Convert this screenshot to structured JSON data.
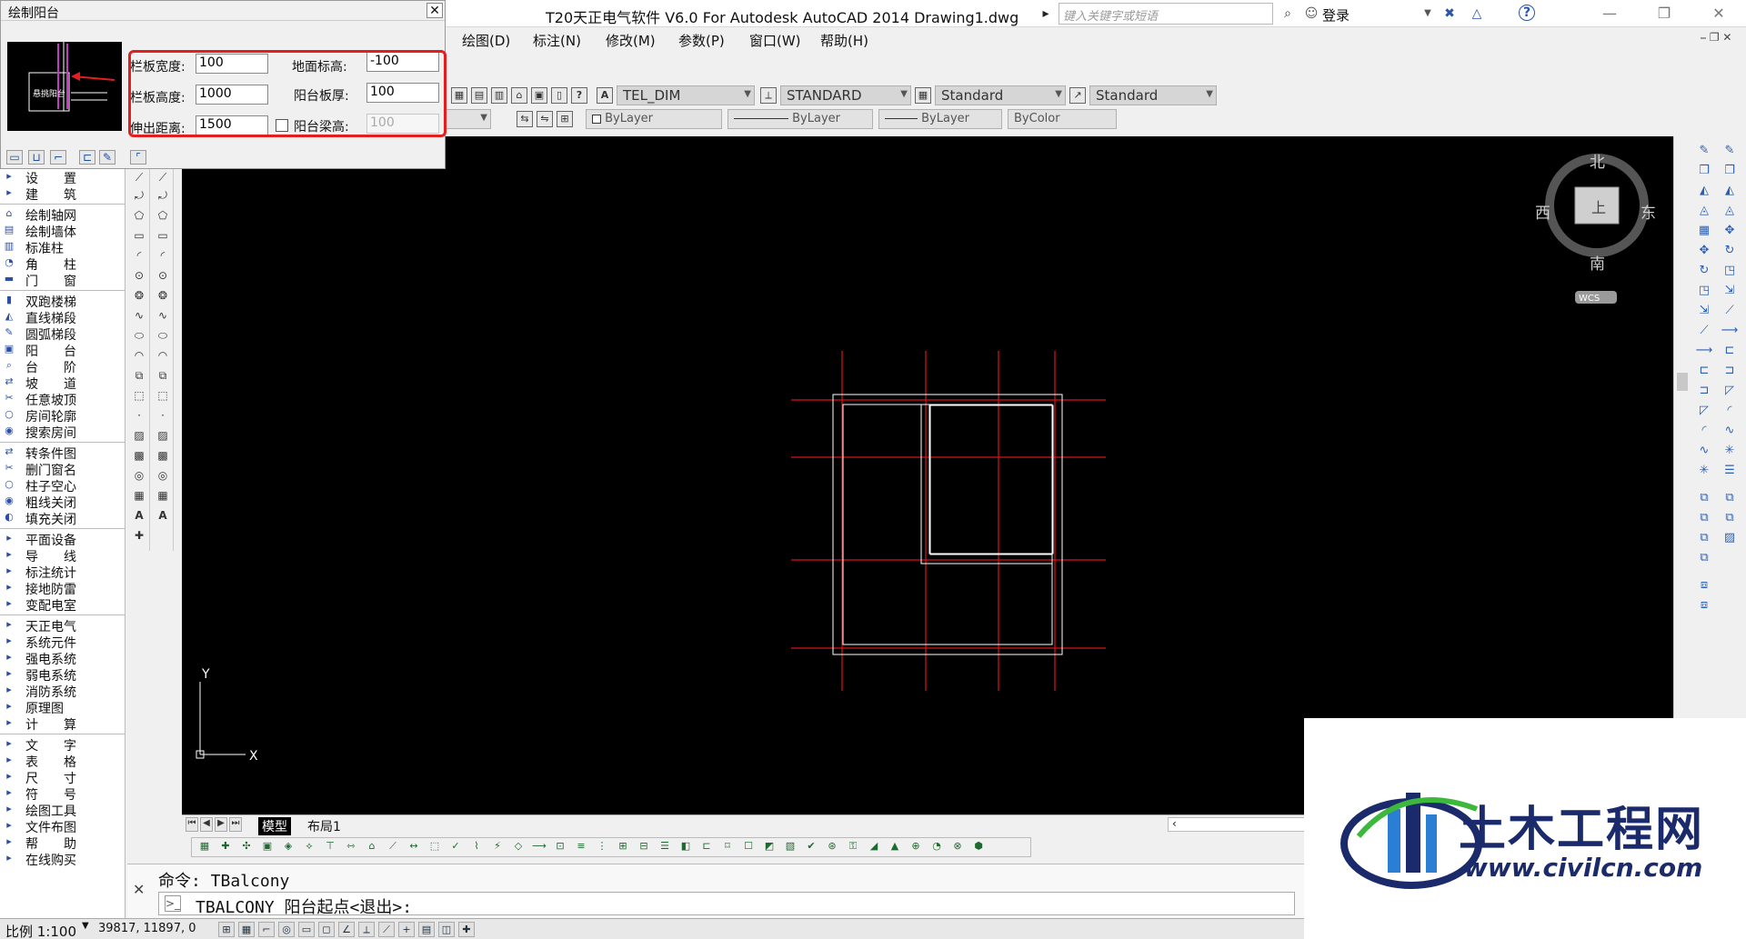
{
  "window": {
    "title": "T20天正电气软件 V6.0 For Autodesk AutoCAD 2014    Drawing1.dwg",
    "search_placeholder": "键入关键字或短语",
    "login_label": "登录",
    "help_label": "?"
  },
  "menubar": {
    "items": [
      "绘图(D)",
      "标注(N)",
      "修改(M)",
      "参数(P)",
      "窗口(W)",
      "帮助(H)"
    ]
  },
  "toolbar": {
    "text_style": "TEL_DIM",
    "dim_style": "STANDARD",
    "table_style": "Standard",
    "multileader_style": "Standard",
    "color": "ByLayer",
    "linetype": "ByLayer",
    "lineweight": "ByLayer",
    "plotstyle": "ByColor"
  },
  "dialog": {
    "title": "绘制阳台",
    "preview_label": "悬挑阳台",
    "fields": {
      "rail_width_label": "栏板宽度:",
      "rail_width": "100",
      "rail_height_label": "栏板高度:",
      "rail_height": "1000",
      "extend_label": "伸出距离:",
      "extend": "1500",
      "ground_elev_label": "地面标高:",
      "ground_elev": "-100",
      "slab_thick_label": "阳台板厚:",
      "slab_thick": "100",
      "beam_height_label": "阳台梁高:",
      "beam_height": "100"
    }
  },
  "left_panel": {
    "groups": [
      [
        "设　　置",
        "建　　筑"
      ],
      [
        "绘制轴网",
        "绘制墙体",
        "标准柱",
        "角　　柱",
        "门　　窗"
      ],
      [
        "双跑楼梯",
        "直线梯段",
        "圆弧梯段",
        "阳　　台",
        "台　　阶",
        "坡　　道",
        "任意坡顶",
        "房间轮廓",
        "搜索房间"
      ],
      [
        "转条件图",
        "删门窗名",
        "柱子空心",
        "粗线关闭",
        "填充关闭"
      ],
      [
        "平面设备",
        "导　　线",
        "标注统计",
        "接地防雷",
        "变配电室"
      ],
      [
        "天正电气",
        "系统元件",
        "强电系统",
        "弱电系统",
        "消防系统",
        "原理图",
        "计　　算"
      ],
      [
        "文　　字",
        "表　　格",
        "尺　　寸",
        "符　　号",
        "绘图工具",
        "文件布图",
        "帮　　助",
        "在线购买"
      ]
    ]
  },
  "viewcube": {
    "north": "北",
    "south": "南",
    "east": "东",
    "west": "西",
    "center": "上",
    "wcs": "WCS"
  },
  "ucs": {
    "y_label": "Y",
    "x_label": "X"
  },
  "tabs": {
    "model": "模型",
    "layout1": "布局1"
  },
  "command": {
    "history": "命令: TBalcony",
    "prompt": "TBALCONY 阳台起点<退出>:"
  },
  "status": {
    "scale": "比例 1:100",
    "coords": "39817, 11897, 0"
  },
  "watermark": {
    "brand": "土木工程网",
    "url": "www.civilcn.com"
  },
  "colors": {
    "canvas": "#000000",
    "axis_red": "#d8141c",
    "wall_white": "#ffffff",
    "highlight_red": "#e41e1e",
    "brand_blue": "#1b2a6a"
  }
}
